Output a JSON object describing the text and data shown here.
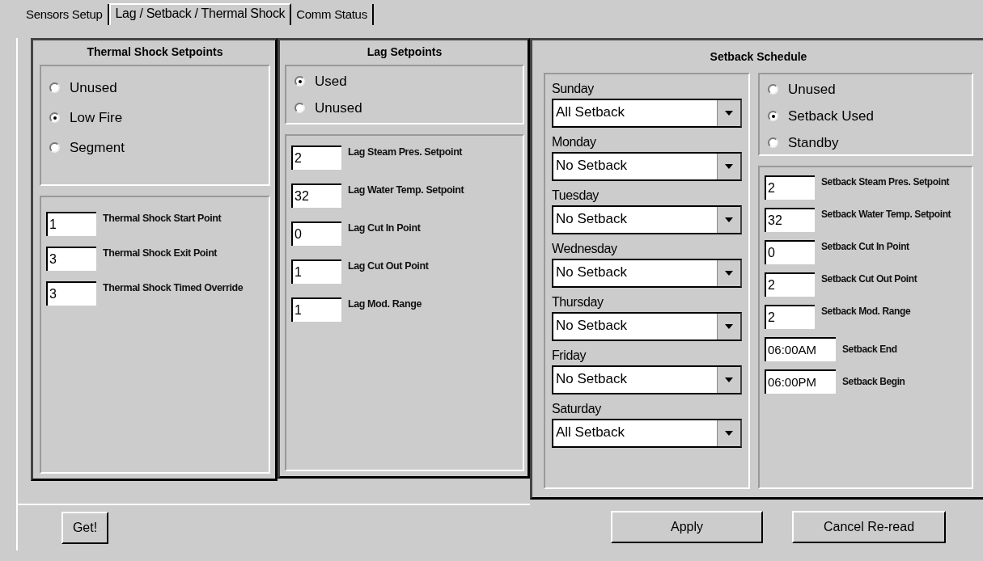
{
  "tabs": [
    {
      "label": "Sensors Setup",
      "selected": false
    },
    {
      "label": "Lag / Setback / Thermal Shock",
      "selected": true
    },
    {
      "label": "Comm Status",
      "selected": false
    }
  ],
  "thermal_shock": {
    "title": "Thermal Shock Setpoints",
    "options": [
      {
        "label": "Unused",
        "selected": false
      },
      {
        "label": "Low Fire",
        "selected": true
      },
      {
        "label": "Segment",
        "selected": false
      }
    ],
    "fields": [
      {
        "value": "1",
        "label": "Thermal Shock Start Point"
      },
      {
        "value": "3",
        "label": "Thermal Shock Exit Point"
      },
      {
        "value": "3",
        "label": "Thermal Shock Timed Override"
      }
    ]
  },
  "lag": {
    "title": "Lag Setpoints",
    "options": [
      {
        "label": "Used",
        "selected": true
      },
      {
        "label": "Unused",
        "selected": false
      }
    ],
    "fields": [
      {
        "value": "2",
        "label": "Lag Steam Pres. Setpoint"
      },
      {
        "value": "32",
        "label": "Lag Water Temp. Setpoint"
      },
      {
        "value": "0",
        "label": "Lag Cut In Point"
      },
      {
        "value": "1",
        "label": "Lag Cut Out Point"
      },
      {
        "value": "1",
        "label": "Lag Mod. Range"
      }
    ]
  },
  "setback": {
    "title": "Setback Schedule",
    "days": [
      {
        "day": "Sunday",
        "value": "All Setback"
      },
      {
        "day": "Monday",
        "value": "No Setback"
      },
      {
        "day": "Tuesday",
        "value": "No Setback"
      },
      {
        "day": "Wednesday",
        "value": "No Setback"
      },
      {
        "day": "Thursday",
        "value": "No Setback"
      },
      {
        "day": "Friday",
        "value": "No Setback"
      },
      {
        "day": "Saturday",
        "value": "All Setback"
      }
    ],
    "options": [
      {
        "label": "Unused",
        "selected": false
      },
      {
        "label": "Setback Used",
        "selected": true
      },
      {
        "label": "Standby",
        "selected": false
      }
    ],
    "fields": [
      {
        "value": "2",
        "label": "Setback Steam Pres. Setpoint"
      },
      {
        "value": "32",
        "label": "Setback Water Temp. Setpoint"
      },
      {
        "value": "0",
        "label": "Setback Cut In Point"
      },
      {
        "value": "2",
        "label": "Setback Cut Out Point"
      },
      {
        "value": "2",
        "label": "Setback Mod. Range"
      },
      {
        "value": "06:00AM",
        "label": "Setback End",
        "kind": "time"
      },
      {
        "value": "06:00PM",
        "label": "Setback Begin",
        "kind": "time"
      }
    ]
  },
  "buttons": [
    {
      "label": "Get!"
    },
    {
      "label": "Apply"
    },
    {
      "label": "Cancel Re-read"
    }
  ]
}
